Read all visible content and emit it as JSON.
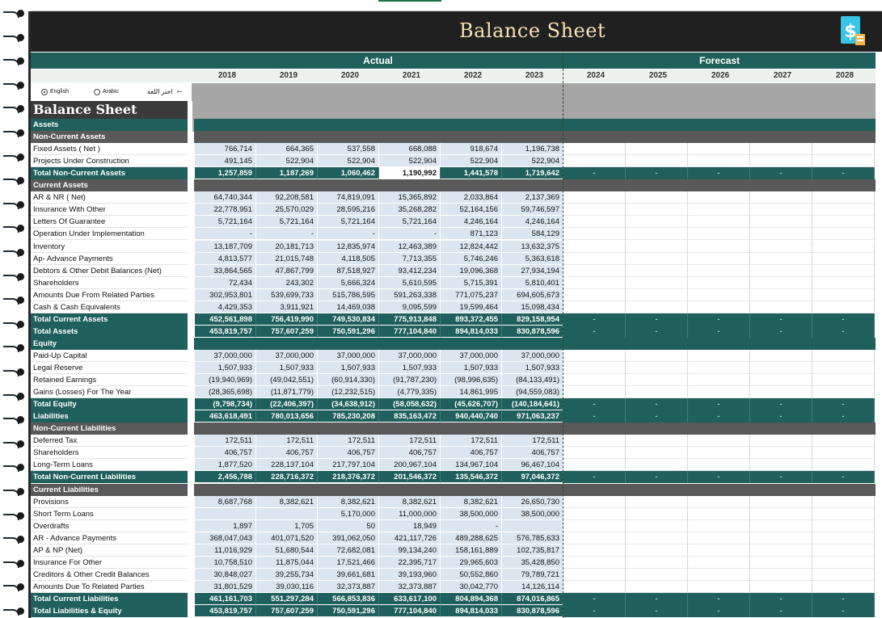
{
  "header": {
    "title": "Balance Sheet",
    "icon": "dollar-document-icon"
  },
  "groups": {
    "actual": "Actual",
    "forecast": "Forecast"
  },
  "years": [
    "2018",
    "2019",
    "2020",
    "2021",
    "2022",
    "2023",
    "2024",
    "2025",
    "2026",
    "2027",
    "2028"
  ],
  "language": {
    "english": "English",
    "arabic": "Arabic",
    "choose": "اختر اللغة",
    "selected": "English"
  },
  "sheet_title": "Balance Sheet",
  "colors": {
    "teal": "#1f5f5c",
    "dark": "#202020",
    "title": "#f6e2b3",
    "actual_cell": "#dce6f1",
    "subheader": "#595959"
  },
  "rows": [
    {
      "type": "section",
      "label": "Assets"
    },
    {
      "type": "sub",
      "label": "Non-Current Assets"
    },
    {
      "type": "data",
      "label": "Fixed Assets ( Net )",
      "values": [
        "766,714",
        "664,365",
        "537,558",
        "668,088",
        "918,674",
        "1,196,738"
      ]
    },
    {
      "type": "data",
      "label": "Projects Under Construction",
      "values": [
        "491,145",
        "522,904",
        "522,904",
        "522,904",
        "522,904",
        "522,904"
      ]
    },
    {
      "type": "total",
      "label": "Total Non-Current Assets",
      "values": [
        "1,257,859",
        "1,187,269",
        "1,060,462",
        "1,190,992",
        "1,441,578",
        "1,719,642"
      ],
      "forecast": [
        "-",
        "-",
        "-",
        "-",
        "-"
      ],
      "selected_index": 3
    },
    {
      "type": "sub",
      "label": "Current Assets"
    },
    {
      "type": "data",
      "label": "AR & NR ( Net)",
      "values": [
        "64,740,344",
        "92,208,581",
        "74,819,091",
        "15,365,892",
        "2,033,864",
        "2,137,369"
      ]
    },
    {
      "type": "data",
      "label": "Insurance With Other",
      "values": [
        "22,778,951",
        "25,570,029",
        "28,595,216",
        "35,268,282",
        "52,164,156",
        "59,746,597"
      ]
    },
    {
      "type": "data",
      "label": "Letters Of Guarantee",
      "values": [
        "5,721,164",
        "5,721,164",
        "5,721,164",
        "5,721,164",
        "4,246,164",
        "4,246,164"
      ]
    },
    {
      "type": "data",
      "label": "Operation Under Implementation",
      "values": [
        "-",
        "-",
        "-",
        "-",
        "871,123",
        "584,129"
      ]
    },
    {
      "type": "data",
      "label": "Inventory",
      "values": [
        "13,187,709",
        "20,181,713",
        "12,835,974",
        "12,463,389",
        "12,824,442",
        "13,632,375"
      ]
    },
    {
      "type": "data",
      "label": "Ap- Advance Payments",
      "values": [
        "4,813,577",
        "21,015,748",
        "4,118,505",
        "7,713,355",
        "5,746,246",
        "5,363,618"
      ]
    },
    {
      "type": "data",
      "label": "Debtors & Other Debit Balances (Net)",
      "values": [
        "33,864,565",
        "47,867,799",
        "87,518,927",
        "93,412,234",
        "19,096,368",
        "27,934,194"
      ]
    },
    {
      "type": "data",
      "label": "Shareholders",
      "values": [
        "72,434",
        "243,302",
        "5,666,324",
        "5,610,595",
        "5,715,391",
        "5,810,401"
      ]
    },
    {
      "type": "data",
      "label": "Amounts Due From Related Parties",
      "values": [
        "302,953,801",
        "539,699,733",
        "515,786,595",
        "591,263,338",
        "771,075,237",
        "694,605,673"
      ]
    },
    {
      "type": "data",
      "label": "Cash & Cash Equivalents",
      "values": [
        "4,429,353",
        "3,911,921",
        "14,469,038",
        "9,095,599",
        "19,599,464",
        "15,098,434"
      ]
    },
    {
      "type": "total",
      "label": "Total Current Assets",
      "values": [
        "452,561,898",
        "756,419,990",
        "749,530,834",
        "775,913,848",
        "893,372,455",
        "829,158,954"
      ],
      "forecast": [
        "-",
        "-",
        "-",
        "-",
        "-"
      ]
    },
    {
      "type": "total",
      "label": "Total Assets",
      "values": [
        "453,819,757",
        "757,607,259",
        "750,591,296",
        "777,104,840",
        "894,814,033",
        "830,878,596"
      ],
      "forecast": [
        "-",
        "-",
        "-",
        "-",
        "-"
      ]
    },
    {
      "type": "section",
      "label": "Equity"
    },
    {
      "type": "data",
      "label": "Paid-Up Capital",
      "values": [
        "37,000,000",
        "37,000,000",
        "37,000,000",
        "37,000,000",
        "37,000,000",
        "37,000,000"
      ]
    },
    {
      "type": "data",
      "label": "Legal Reserve",
      "values": [
        "1,507,933",
        "1,507,933",
        "1,507,933",
        "1,507,933",
        "1,507,933",
        "1,507,933"
      ]
    },
    {
      "type": "data",
      "label": "Retained Earnings",
      "values": [
        "(19,940,969)",
        "(49,042,551)",
        "(60,914,330)",
        "(91,787,230)",
        "(98,996,635)",
        "(84,133,491)"
      ]
    },
    {
      "type": "data",
      "label": "Gains (Losses) For The Year",
      "values": [
        "(28,365,698)",
        "(11,871,779)",
        "(12,232,515)",
        "(4,779,335)",
        "14,861,995",
        "(94,559,083)"
      ]
    },
    {
      "type": "total",
      "label": "Total Equity",
      "values": [
        "(9,798,734)",
        "(22,406,397)",
        "(34,638,912)",
        "(58,058,632)",
        "(45,626,707)",
        "(140,184,641)"
      ],
      "forecast": [
        "-",
        "-",
        "-",
        "-",
        "-"
      ]
    },
    {
      "type": "total",
      "label": "Liabilities",
      "values": [
        "463,618,491",
        "780,013,656",
        "785,230,208",
        "835,163,472",
        "940,440,740",
        "971,063,237"
      ],
      "forecast": [
        "-",
        "-",
        "-",
        "-",
        "-"
      ]
    },
    {
      "type": "sub",
      "label": "Non-Current Liabilities"
    },
    {
      "type": "data",
      "label": "Deferred Tax",
      "values": [
        "172,511",
        "172,511",
        "172,511",
        "172,511",
        "172,511",
        "172,511"
      ]
    },
    {
      "type": "data",
      "label": "Shareholders",
      "values": [
        "406,757",
        "406,757",
        "406,757",
        "406,757",
        "406,757",
        "406,757"
      ]
    },
    {
      "type": "data",
      "label": "Long-Term Loans",
      "values": [
        "1,877,520",
        "228,137,104",
        "217,797,104",
        "200,967,104",
        "134,967,104",
        "96,467,104"
      ]
    },
    {
      "type": "total",
      "label": "Total Non-Current Liabilities",
      "values": [
        "2,456,788",
        "228,716,372",
        "218,376,372",
        "201,546,372",
        "135,546,372",
        "97,046,372"
      ],
      "forecast": [
        "-",
        "-",
        "-",
        "-",
        "-"
      ]
    },
    {
      "type": "sub",
      "label": "Current Liabilities"
    },
    {
      "type": "data",
      "label": "Provisions",
      "values": [
        "8,687,768",
        "8,382,621",
        "8,382,621",
        "8,382,621",
        "8,382,621",
        "26,650,730"
      ]
    },
    {
      "type": "data",
      "label": "Short Term Loans",
      "values": [
        "",
        "",
        "5,170,000",
        "11,000,000",
        "38,500,000",
        "38,500,000"
      ]
    },
    {
      "type": "data",
      "label": "Overdrafts",
      "values": [
        "1,897",
        "1,705",
        "50",
        "18,949",
        "-",
        ""
      ]
    },
    {
      "type": "data",
      "label": "AR - Advance Payments",
      "values": [
        "368,047,043",
        "401,071,520",
        "391,062,050",
        "421,117,726",
        "489,288,625",
        "576,785,633"
      ]
    },
    {
      "type": "data",
      "label": "AP & NP (Net)",
      "values": [
        "11,016,929",
        "51,680,544",
        "72,682,081",
        "99,134,240",
        "158,161,889",
        "102,735,817"
      ]
    },
    {
      "type": "data",
      "label": "Insurance For Other",
      "values": [
        "10,758,510",
        "11,875,044",
        "17,521,466",
        "22,395,717",
        "29,965,603",
        "35,428,850"
      ]
    },
    {
      "type": "data",
      "label": "Creditors & Other Credit Balances",
      "values": [
        "30,848,027",
        "39,255,734",
        "39,661,681",
        "39,193,960",
        "50,552,860",
        "79,789,721"
      ]
    },
    {
      "type": "data",
      "label": "Amounts Due To Related Parties",
      "values": [
        "31,801,529",
        "39,030,116",
        "32,373,887",
        "32,373,887",
        "30,042,770",
        "14,126,114"
      ]
    },
    {
      "type": "total",
      "label": "Total Current Liabilities",
      "values": [
        "461,161,703",
        "551,297,284",
        "566,853,836",
        "633,617,100",
        "804,894,368",
        "874,016,865"
      ],
      "forecast": [
        "-",
        "-",
        "-",
        "-",
        "-"
      ]
    },
    {
      "type": "total",
      "label": "Total Liabilities & Equity",
      "values": [
        "453,819,757",
        "757,607,259",
        "750,591,296",
        "777,104,840",
        "894,814,033",
        "830,878,596"
      ],
      "forecast": [
        "-",
        "-",
        "-",
        "-",
        "-"
      ]
    }
  ]
}
